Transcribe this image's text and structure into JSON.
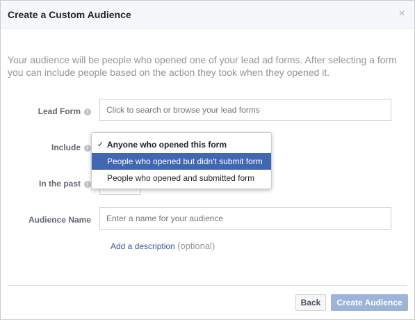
{
  "dialog": {
    "title": "Create a Custom Audience",
    "close_symbol": "×"
  },
  "intro_text": "Your audience will be people who opened one of your lead ad forms. After selecting a form you can include people based on the action they took when they opened it.",
  "form": {
    "lead_form_label": "Lead Form",
    "lead_form_placeholder": "Click to search or browse your lead forms",
    "include_label": "Include",
    "include_options": [
      {
        "label": "Anyone who opened this form",
        "checked": true
      },
      {
        "label": "People who opened but didn't submit form",
        "highlighted": true
      },
      {
        "label": "People who opened and submitted form"
      }
    ],
    "past_label": "In the past",
    "audience_name_label": "Audience Name",
    "audience_name_placeholder": "Enter a name for your audience",
    "add_description_link": "Add a description",
    "optional_text": "(optional)",
    "info_symbol": "i",
    "check_symbol": "✓"
  },
  "footer": {
    "back_label": "Back",
    "create_label": "Create Audience"
  },
  "colors": {
    "highlight": "#4267b2",
    "link": "#365899",
    "create_button_disabled": "#9cb4d8"
  }
}
